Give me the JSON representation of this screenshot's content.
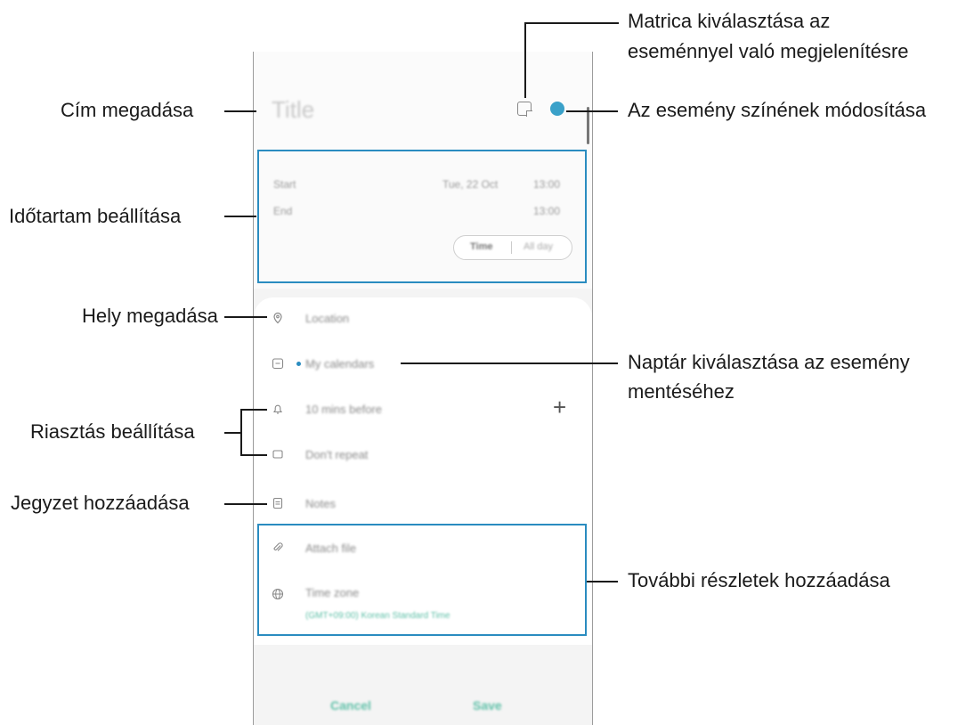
{
  "annotations": {
    "title": "Cím megadása",
    "sticker_line1": "Matrica kiválasztása az",
    "sticker_line2": "eseménnyel való megjelenítésre",
    "color": "Az esemény színének módosítása",
    "duration": "Időtartam beállítása",
    "location": "Hely megadása",
    "calendar_line1": "Naptár kiválasztása az esemény",
    "calendar_line2": "mentéséhez",
    "alarm": "Riasztás beállítása",
    "notes": "Jegyzet hozzáadása",
    "more_details": "További részletek hozzáadása"
  },
  "event_form": {
    "title_placeholder": "Title",
    "start_label": "Start",
    "start_date": "Tue, 22 Oct",
    "start_time": "13:00",
    "end_label": "End",
    "end_time": "13:00",
    "time_toggle": "Time",
    "all_day_toggle": "All day",
    "location_placeholder": "Location",
    "calendar_value": "My calendars",
    "reminder_value": "10 mins before",
    "repeat_value": "Don't repeat",
    "notes_placeholder": "Notes",
    "attach_label": "Attach file",
    "timezone_label": "Time zone",
    "timezone_value": "(GMT+09:00) Korean Standard Time",
    "cancel_label": "Cancel",
    "save_label": "Save"
  },
  "colors": {
    "event_color": "#3aa1c9",
    "highlight": "#2a8cc0",
    "accent_green": "#5fc0a8"
  }
}
